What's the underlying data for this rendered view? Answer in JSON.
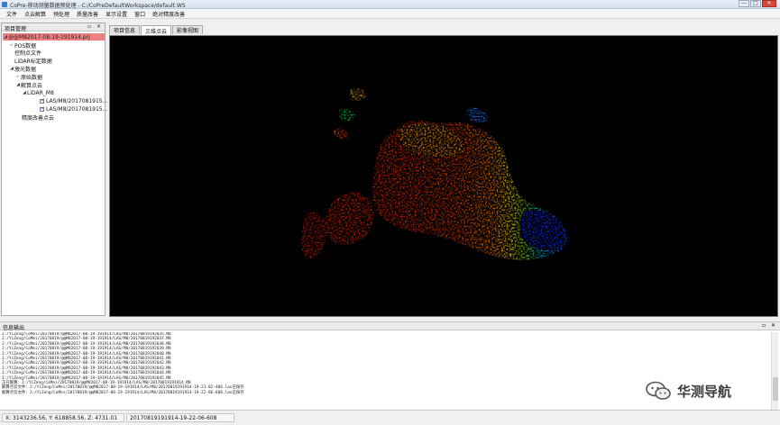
{
  "window": {
    "title": "CoPre-移动测量数据预处理 - C:/CoPreDefaultWorkspace/default.WS",
    "buttons": {
      "minimize": "—",
      "maximize": "□",
      "close": "✕"
    }
  },
  "menu": [
    "文件",
    "点云解算",
    "预处理",
    "质量改善",
    "显示设置",
    "窗口",
    "绝对精度改善"
  ],
  "project_panel": {
    "title": "项目管理",
    "header_buttons": "▫ ✕",
    "tree": [
      {
        "label": "@@M82017-08-19-191914.prj",
        "selected": true,
        "arrow": "◢"
      },
      {
        "label": "POS数据",
        "arrow": "▹"
      },
      {
        "label": "控制点文件",
        "arrow": ""
      },
      {
        "label": "LiDAR标定数据",
        "arrow": ""
      },
      {
        "label": "激光数据",
        "arrow": "◢"
      },
      {
        "label": "原始数据",
        "arrow": "▹"
      },
      {
        "label": "解算点云",
        "arrow": "◢"
      },
      {
        "label": "LiDAR_M8",
        "arrow": "◢"
      },
      {
        "label": "LAS/M8/2017081915...",
        "arrow": "",
        "checked": true
      },
      {
        "label": "LAS/M8/2017081915...",
        "arrow": "",
        "checked": true
      },
      {
        "label": "精度改善点云",
        "arrow": ""
      }
    ]
  },
  "viewer": {
    "tabs": [
      "项目信息",
      "三维点云",
      "影像视图"
    ],
    "active_tab": 1
  },
  "output_panel": {
    "title": "信息输出",
    "header_buttons": "▫ ✕",
    "log": [
      "J:/YiZeng/CoMei/20170819/@@M82017-08-19-191914/LAS/M8/20170819192035.M8",
      "J:/YiZeng/CoMei/20170819/@@M82017-08-19-191914/LAS/M8/20170819192037.M8",
      "J:/YiZeng/CoMei/20170819/@@M82017-08-19-191914/LAS/M8/20170819192038.M8",
      "J:/YiZeng/CoMei/20170819/@@M82017-08-19-191914/LAS/M8/20170819192039.M8",
      "J:/YiZeng/CoMei/20170819/@@M82017-08-19-191914/LAS/M8/20170819192040.M8",
      "J:/YiZeng/CoMei/20170819/@@M82017-08-19-191914/LAS/M8/20170819192041.M8",
      "J:/YiZeng/CoMei/20170819/@@M82017-08-19-191914/LAS/M8/20170819192042.M8",
      "J:/YiZeng/CoMei/20170819/@@M82017-08-19-191914/LAS/M8/20170819192043.M8",
      "J:/YiZeng/CoMei/20170819/@@M82017-08-19-191914/LAS/M8/20170819192044.M8",
      "J:/YiZeng/CoMei/20170819/@@M82017-08-19-191914/LAS/M8/20170819192045.M8",
      "正在解算：J:/YiZeng/CoMei/20170819/@@M82017-08-19-191914/LAS/M8/20170819191914.M8",
      "    解算点云文件：J:/YiZeng/CoMei/20170819/@@M82017-08-19-191914/LAS/M8/20170819191914-19-21-02-406.las已保存",
      "    解算点云文件：J:/YiZeng/CoMei/20170819/@@M82017-08-19-191914/LAS/M8/20170819191914-19-22-06-608.las已保存"
    ]
  },
  "status_bar": {
    "coords": "X: 3143236.56, Y: 618858.56, Z: 4731.01",
    "file": "20170819191914-19-22-06-608"
  },
  "watermark": {
    "text": "华测导航"
  },
  "colors": {
    "selected_row": "#f08080",
    "canvas_bg": "#000000",
    "point_cloud_ramp": [
      "#d81e05",
      "#ff6a00",
      "#ffd200",
      "#9be000",
      "#00d0a0",
      "#0090ff",
      "#0a2cff"
    ]
  }
}
